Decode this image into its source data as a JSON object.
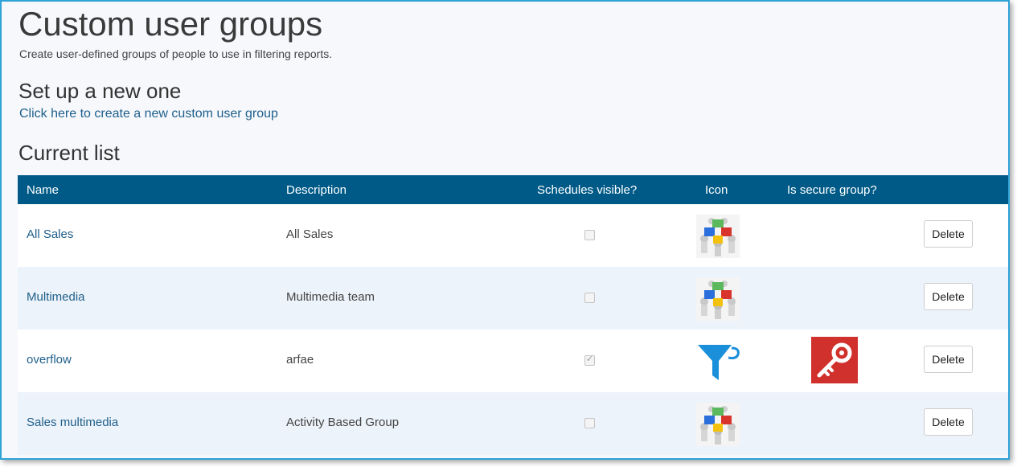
{
  "header": {
    "title": "Custom user groups",
    "subtitle": "Create user-defined groups of people to use in filtering reports."
  },
  "setup": {
    "title": "Set up a new one",
    "link": "Click here to create a new custom user group"
  },
  "current": {
    "title": "Current list"
  },
  "table": {
    "columns": {
      "name": "Name",
      "description": "Description",
      "schedules": "Schedules visible?",
      "icon": "Icon",
      "secure": "Is secure group?"
    },
    "rows": [
      {
        "name": "All Sales",
        "description": "All Sales",
        "schedules_visible": false,
        "icon": "people-puzzle-icon",
        "secure": false,
        "delete_label": "Delete"
      },
      {
        "name": "Multimedia",
        "description": "Multimedia team",
        "schedules_visible": false,
        "icon": "people-puzzle-icon",
        "secure": false,
        "delete_label": "Delete"
      },
      {
        "name": "overflow",
        "description": "arfae",
        "schedules_visible": true,
        "icon": "funnel-icon",
        "secure": true,
        "secure_icon": "key-icon",
        "delete_label": "Delete"
      },
      {
        "name": "Sales multimedia",
        "description": "Activity Based Group",
        "schedules_visible": false,
        "icon": "people-puzzle-icon",
        "secure": false,
        "delete_label": "Delete"
      }
    ]
  },
  "colors": {
    "header_bg": "#005a87",
    "link": "#1f5f8b",
    "alt_row": "#edf3fa",
    "frame_border": "#2ea3d8",
    "funnel": "#1b8fd9",
    "key_bg": "#d0312d"
  }
}
